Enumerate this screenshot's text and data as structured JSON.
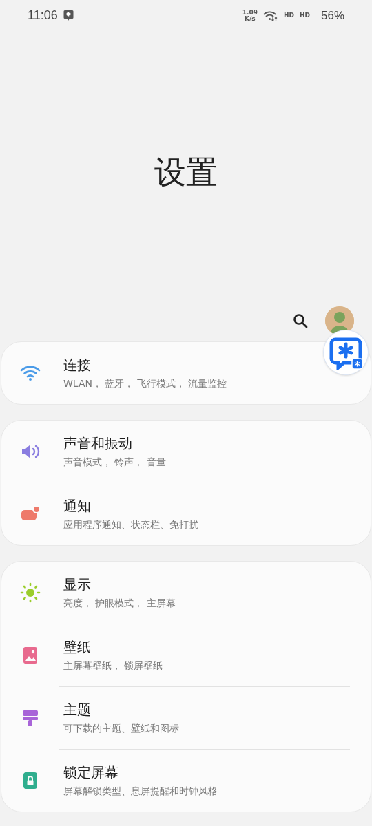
{
  "status_bar": {
    "time": "11:06",
    "speed": "1.09",
    "speed_unit": "K/s",
    "network_labels": [
      "HD",
      "HD"
    ],
    "battery": "56%"
  },
  "title": "设置",
  "groups": [
    {
      "items": [
        {
          "kind": "wifi",
          "color": "#4a9be8",
          "title": "连接",
          "subtitle": "WLAN， 蓝牙， 飞行模式， 流量监控"
        }
      ]
    },
    {
      "items": [
        {
          "kind": "sound",
          "color": "#8a7de0",
          "title": "声音和振动",
          "subtitle": "声音模式， 铃声， 音量"
        },
        {
          "kind": "notification",
          "color": "#ee7a6b",
          "title": "通知",
          "subtitle": "应用程序通知、状态栏、免打扰"
        }
      ]
    },
    {
      "items": [
        {
          "kind": "display",
          "color": "#9acd2a",
          "title": "显示",
          "subtitle": "亮度， 护眼模式， 主屏幕"
        },
        {
          "kind": "wallpaper",
          "color": "#e86a8e",
          "title": "壁纸",
          "subtitle": "主屏幕壁纸， 锁屏壁纸"
        },
        {
          "kind": "theme",
          "color": "#a864d8",
          "title": "主题",
          "subtitle": "可下载的主题、壁纸和图标"
        },
        {
          "kind": "lock",
          "color": "#2fae8e",
          "title": "锁定屏幕",
          "subtitle": "屏幕解锁类型、息屏提醒和时钟风格"
        }
      ]
    }
  ]
}
